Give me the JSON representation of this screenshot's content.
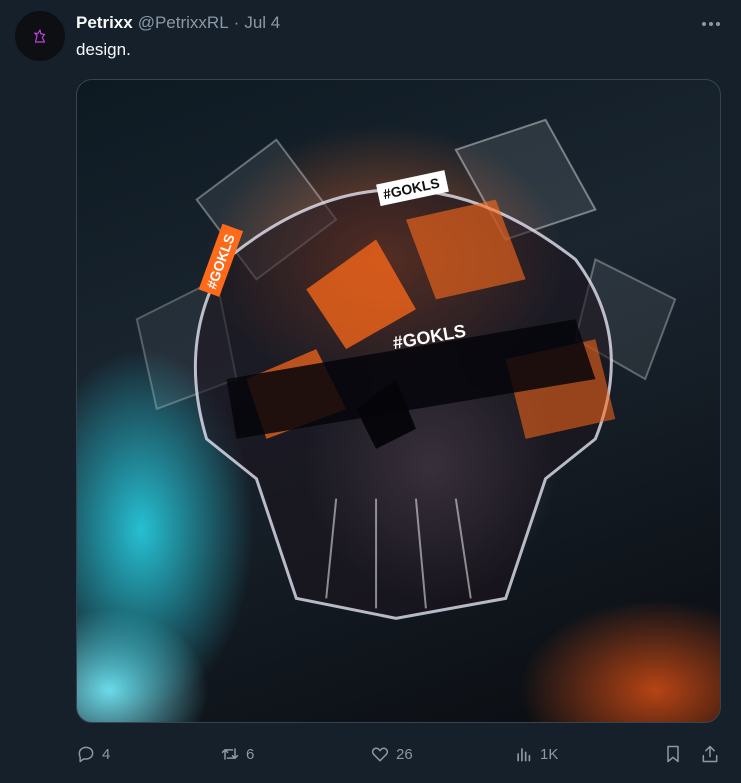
{
  "tweet": {
    "author": {
      "name": "Petrixx",
      "handle": "@PetrixxRL",
      "separator": "·",
      "time": "Jul 4",
      "avatar_icon": "unicorn-logo-icon"
    },
    "text": "design.",
    "media": {
      "overlay_texts": [
        "#GOKLS",
        "#GOKLS",
        "#GOKLS"
      ],
      "accent_colors": [
        "#ff6a1a",
        "#2ad6ef"
      ]
    },
    "actions": {
      "reply_count": "4",
      "retweet_count": "6",
      "like_count": "26",
      "views_count": "1K"
    },
    "colors": {
      "background": "#15202b",
      "secondary_text": "#8b98a5",
      "primary_text": "#f7f9f9",
      "border": "#38444d"
    }
  }
}
